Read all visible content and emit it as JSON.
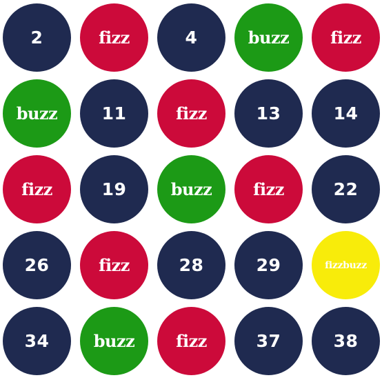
{
  "colors": {
    "number": "#1f2a50",
    "fizz": "#cc0a3a",
    "buzz": "#1c9a16",
    "fizzbuzz": "#f8ec0a",
    "text": "#ffffff"
  },
  "cells": [
    {
      "label": "2",
      "kind": "number"
    },
    {
      "label": "fizz",
      "kind": "fizz"
    },
    {
      "label": "4",
      "kind": "number"
    },
    {
      "label": "buzz",
      "kind": "buzz"
    },
    {
      "label": "fizz",
      "kind": "fizz"
    },
    {
      "label": "buzz",
      "kind": "buzz"
    },
    {
      "label": "11",
      "kind": "number"
    },
    {
      "label": "fizz",
      "kind": "fizz"
    },
    {
      "label": "13",
      "kind": "number"
    },
    {
      "label": "14",
      "kind": "number"
    },
    {
      "label": "fizz",
      "kind": "fizz"
    },
    {
      "label": "19",
      "kind": "number"
    },
    {
      "label": "buzz",
      "kind": "buzz"
    },
    {
      "label": "fizz",
      "kind": "fizz"
    },
    {
      "label": "22",
      "kind": "number"
    },
    {
      "label": "26",
      "kind": "number"
    },
    {
      "label": "fizz",
      "kind": "fizz"
    },
    {
      "label": "28",
      "kind": "number"
    },
    {
      "label": "29",
      "kind": "number"
    },
    {
      "label": "fizzbuzz",
      "kind": "fizzbuzz"
    },
    {
      "label": "34",
      "kind": "number"
    },
    {
      "label": "buzz",
      "kind": "buzz"
    },
    {
      "label": "fizz",
      "kind": "fizz"
    },
    {
      "label": "37",
      "kind": "number"
    },
    {
      "label": "38",
      "kind": "number"
    }
  ]
}
